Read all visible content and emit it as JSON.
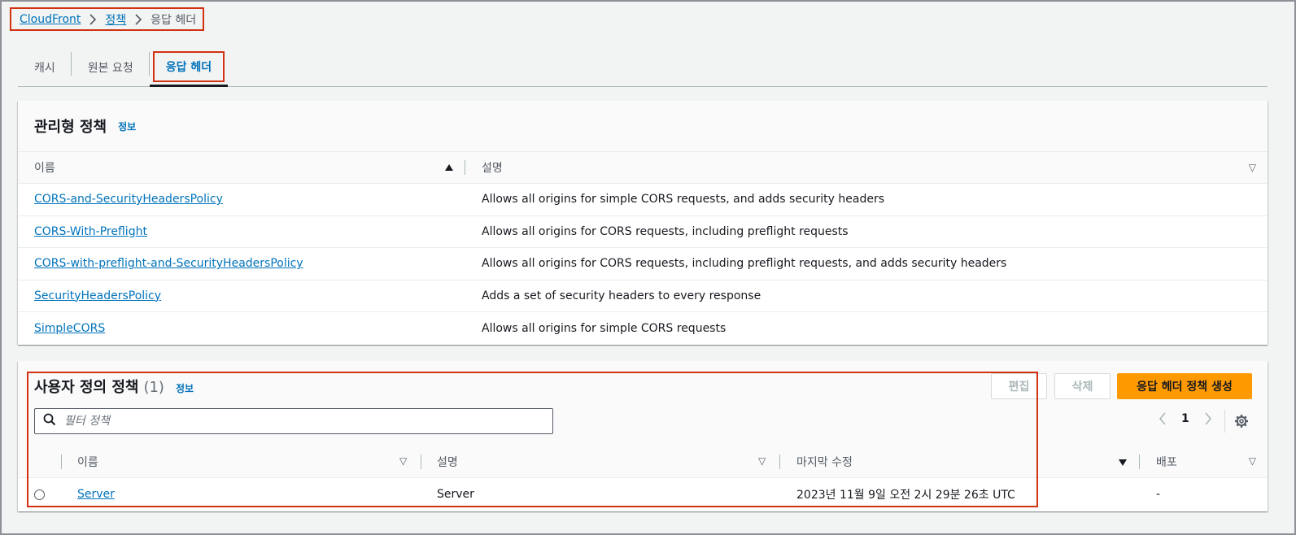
{
  "breadcrumb": {
    "items": [
      "CloudFront",
      "정책"
    ],
    "current": "응답 헤더"
  },
  "tabs": [
    {
      "label": "캐시"
    },
    {
      "label": "원본 요청"
    },
    {
      "label": "응답 헤더"
    }
  ],
  "managed": {
    "title": "관리형 정책",
    "info": "정보",
    "columns": [
      "이름",
      "설명"
    ],
    "rows": [
      {
        "name": "CORS-and-SecurityHeadersPolicy",
        "desc": "Allows all origins for simple CORS requests, and adds security headers"
      },
      {
        "name": "CORS-With-Preflight",
        "desc": "Allows all origins for CORS requests, including preflight requests"
      },
      {
        "name": "CORS-with-preflight-and-SecurityHeadersPolicy",
        "desc": "Allows all origins for CORS requests, including preflight requests, and adds security headers"
      },
      {
        "name": "SecurityHeadersPolicy",
        "desc": "Adds a set of security headers to every response"
      },
      {
        "name": "SimpleCORS",
        "desc": "Allows all origins for simple CORS requests"
      }
    ]
  },
  "custom": {
    "title": "사용자 정의 정책",
    "count": "(1)",
    "info": "정보",
    "buttons": {
      "edit": "편집",
      "delete": "삭제",
      "create": "응답 헤더 정책 생성"
    },
    "filter_placeholder": "필터 정책",
    "page": "1",
    "columns": [
      "이름",
      "설명",
      "마지막 수정",
      "배포"
    ],
    "rows": [
      {
        "name": "Server",
        "desc": "Server",
        "modified": "2023년 11월 9일 오전 2시 29분 26초 UTC",
        "dist": "-"
      }
    ]
  }
}
